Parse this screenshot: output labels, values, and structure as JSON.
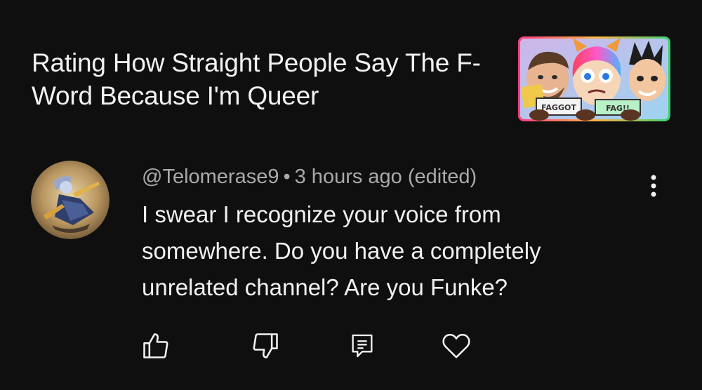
{
  "video": {
    "title": "Rating How Straight People Say The F-Word Because I'm Queer",
    "thumbnail": {
      "alt": "video-thumbnail",
      "sign_left": "FAGGOT",
      "sign_right": "FAG!!"
    }
  },
  "comment": {
    "author": "@Telomerase9",
    "separator": "•",
    "timestamp": "3 hours ago (edited)",
    "text": "I swear I recognize your voice from somewhere. Do you have a completely unrelated channel? Are you Funke?"
  },
  "actions": {
    "like_icon": "thumbs-up-icon",
    "dislike_icon": "thumbs-down-icon",
    "reply_icon": "reply-comment-icon",
    "heart_icon": "heart-icon",
    "more_icon": "more-vertical-icon"
  },
  "colors": {
    "background": "#0f0f0f",
    "text_primary": "#f1f1f1",
    "text_secondary": "#aaaaaa"
  }
}
